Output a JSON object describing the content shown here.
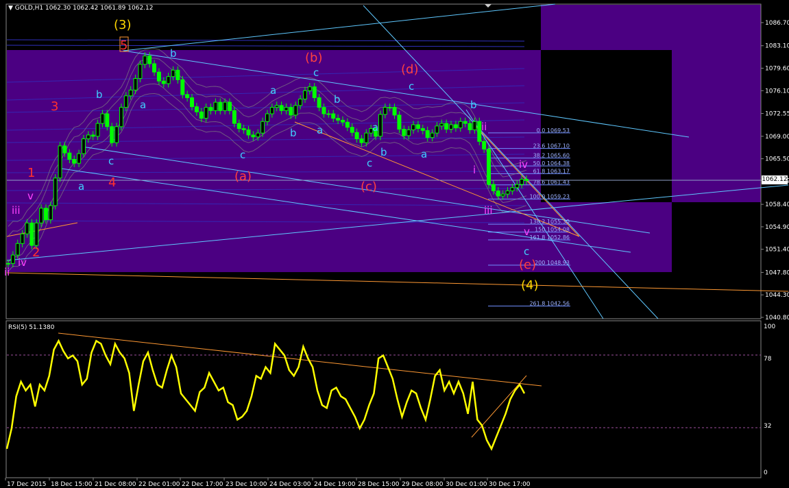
{
  "header": {
    "symbol": "GOLD,H1",
    "ohlc": "1062.30 1062.42 1061.89 1062.12",
    "last_price": "1062.12"
  },
  "rsi_header": "RSI(5) 51.1380",
  "colors": {
    "background": "#000000",
    "zone": "#4b0082",
    "candle": "#00ff00",
    "rsi_line": "#ffff00",
    "fib": "#6f8fff",
    "channel": "#5fc8ff",
    "trend": "#ff9933"
  },
  "chart_data": [
    {
      "type": "candlestick",
      "title": "GOLD,H1",
      "y_range": [
        1040.8,
        1088.6
      ],
      "y_ticks": [
        "1086.70",
        "1083.10",
        "1079.60",
        "1076.10",
        "1072.55",
        "1069.00",
        "1065.50",
        "1062.12",
        "1058.40",
        "1054.90",
        "1051.40",
        "1047.80",
        "1044.30",
        "1040.80"
      ],
      "x_ticks": [
        "17 Dec 2015",
        "18 Dec 15:00",
        "21 Dec 08:00",
        "22 Dec 01:00",
        "22 Dec 17:00",
        "23 Dec 10:00",
        "24 Dec 03:00",
        "24 Dec 19:00",
        "28 Dec 15:00",
        "29 Dec 08:00",
        "30 Dec 01:00",
        "30 Dec 17:00"
      ],
      "close_path": [
        1049.2,
        1050.5,
        1052.3,
        1053.8,
        1055.5,
        1052.0,
        1055.5,
        1057.8,
        1056.0,
        1058.2,
        1062.5,
        1067.5,
        1066.4,
        1065.4,
        1064.8,
        1066.3,
        1068.6,
        1069.2,
        1069.0,
        1071.0,
        1072.5,
        1070.5,
        1068.0,
        1070.5,
        1073.5,
        1075.3,
        1076.2,
        1078.0,
        1080.2,
        1081.5,
        1080.3,
        1079.0,
        1077.6,
        1077.2,
        1078.3,
        1079.3,
        1077.8,
        1075.5,
        1075.0,
        1073.6,
        1072.8,
        1071.8,
        1073.5,
        1073.0,
        1074.3,
        1073.0,
        1074.3,
        1073.0,
        1071.0,
        1070.2,
        1070.0,
        1069.2,
        1068.9,
        1069.5,
        1071.3,
        1072.5,
        1073.5,
        1073.8,
        1073.0,
        1073.5,
        1072.3,
        1073.8,
        1074.8,
        1076.1,
        1076.7,
        1075.0,
        1073.5,
        1072.5,
        1072.5,
        1071.8,
        1071.5,
        1071.2,
        1070.4,
        1069.6,
        1068.6,
        1068.0,
        1069.5,
        1070.2,
        1069.0,
        1072.4,
        1073.5,
        1073.5,
        1072.3,
        1070.1,
        1069.1,
        1070.0,
        1070.8,
        1070.2,
        1069.9,
        1068.8,
        1069.5,
        1070.6,
        1071.0,
        1070.1,
        1070.8,
        1070.3,
        1071.3,
        1071.0,
        1070.0,
        1071.3,
        1068.2,
        1067.0,
        1061.5,
        1060.5,
        1059.7,
        1060.0,
        1060.5,
        1061.0,
        1061.5,
        1062.3,
        1062.1
      ],
      "fib_levels": [
        {
          "label": "0.0 1069.53",
          "price": 1069.53
        },
        {
          "label": "23.6 1067.10",
          "price": 1067.1
        },
        {
          "label": "38.2 1065.60",
          "price": 1065.6
        },
        {
          "label": "50.0 1064.38",
          "price": 1064.38
        },
        {
          "label": "61.8 1063.17",
          "price": 1063.17
        },
        {
          "label": "78.6 1061.43",
          "price": 1061.43
        },
        {
          "label": "100.0 1059.23",
          "price": 1059.23
        },
        {
          "label": "138.2 1055.30",
          "price": 1055.3
        },
        {
          "label": "150 1054.08",
          "price": 1054.08
        },
        {
          "label": "161.8 1052.86",
          "price": 1052.86
        },
        {
          "label": "200 1048.93",
          "price": 1048.93
        },
        {
          "label": "261.8 1042.56",
          "price": 1042.56
        }
      ],
      "wave_labels": {
        "yellow": [
          "(3)",
          "(4)"
        ],
        "red": [
          "1",
          "2",
          "3",
          "4",
          "5",
          "(a)",
          "(b)",
          "(c)",
          "(d)",
          "(e)"
        ],
        "cyan": [
          "a",
          "b",
          "c",
          "a",
          "b",
          "c",
          "a",
          "b",
          "c",
          "a",
          "b",
          "c",
          "a",
          "b",
          "c",
          "a",
          "b",
          "c",
          "b"
        ],
        "magenta": [
          "iii",
          "iv",
          "v",
          "i",
          "ii",
          "iii",
          "iv",
          "v",
          "ii"
        ]
      }
    },
    {
      "type": "line",
      "title": "RSI(5) 51.1380",
      "y_range": [
        0,
        100
      ],
      "y_ticks": [
        "100",
        "78",
        "32",
        "0"
      ],
      "values": [
        16,
        30,
        52,
        62,
        56,
        60,
        45,
        60,
        56,
        66,
        84,
        90,
        83,
        78,
        80,
        76,
        60,
        64,
        82,
        90,
        88,
        80,
        74,
        88,
        82,
        78,
        68,
        42,
        60,
        76,
        82,
        70,
        60,
        58,
        70,
        80,
        72,
        54,
        50,
        46,
        42,
        55,
        58,
        68,
        62,
        56,
        58,
        48,
        46,
        36,
        38,
        42,
        52,
        66,
        64,
        72,
        68,
        88,
        84,
        80,
        70,
        66,
        72,
        86,
        78,
        72,
        56,
        46,
        44,
        56,
        58,
        52,
        50,
        44,
        38,
        30,
        36,
        46,
        54,
        78,
        80,
        72,
        64,
        50,
        38,
        48,
        56,
        54,
        44,
        36,
        50,
        66,
        70,
        56,
        62,
        54,
        62,
        54,
        40,
        62,
        36,
        32,
        22,
        16,
        24,
        32,
        40,
        50,
        56,
        60,
        54
      ]
    }
  ]
}
